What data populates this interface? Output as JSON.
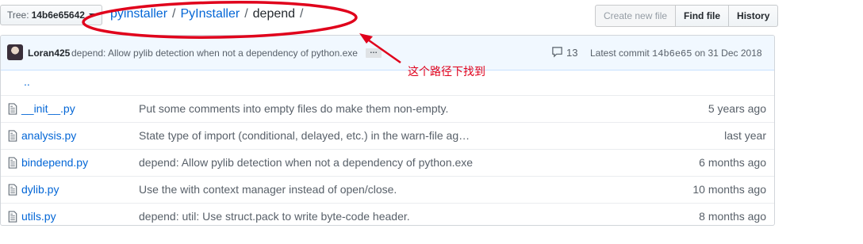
{
  "tree": {
    "label": "Tree:",
    "sha": "14b6e65642"
  },
  "breadcrumb": {
    "root": "pyinstaller",
    "sub": "PyInstaller",
    "sep": "/",
    "current": "depend",
    "trail_sep": "/"
  },
  "actions": {
    "create_new_file": "Create new file",
    "find_file": "Find file",
    "history": "History"
  },
  "commit": {
    "author": "Loran425",
    "message": "depend: Allow pylib detection when not a dependency of python.exe",
    "ellipsis": "…",
    "comments": "13",
    "latest_prefix": "Latest commit",
    "latest_sha": "14b6e65",
    "latest_date": "on 31 Dec 2018"
  },
  "up_dir": "..",
  "files": [
    {
      "name": "__init__.py",
      "message": "Put some comments into empty files do make them non-empty.",
      "age": "5 years ago"
    },
    {
      "name": "analysis.py",
      "message": "State type of import (conditional, delayed, etc.) in the warn-file ag…",
      "age": "last year"
    },
    {
      "name": "bindepend.py",
      "message": "depend: Allow pylib detection when not a dependency of python.exe",
      "age": "6 months ago"
    },
    {
      "name": "dylib.py",
      "message": "Use the with context manager instead of open/close.",
      "age": "10 months ago"
    },
    {
      "name": "utils.py",
      "message": "depend: util: Use struct.pack to write byte-code header.",
      "age": "8 months ago"
    }
  ],
  "annotation": {
    "text": "这个路径下找到",
    "color": "#e0001b"
  }
}
